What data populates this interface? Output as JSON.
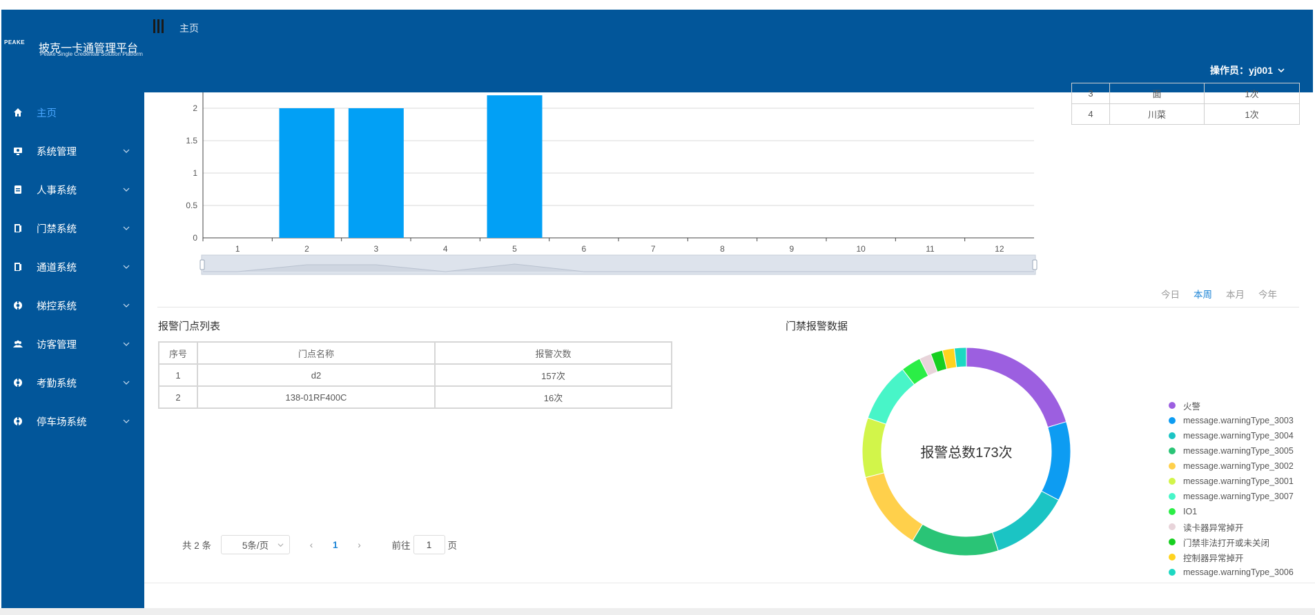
{
  "header": {
    "logo_mark": "PEAKE",
    "brand_title": "披克一卡通管理平台",
    "brand_subtitle": "Peake Single Credential Solution Platform",
    "breadcrumb": "主页",
    "operator": "操作员：yj001"
  },
  "sidebar": {
    "items": [
      {
        "label": "主页",
        "icon": "home-icon",
        "active": true
      },
      {
        "label": "系统管理",
        "icon": "monitor-icon"
      },
      {
        "label": "人事系统",
        "icon": "id-card-icon"
      },
      {
        "label": "门禁系统",
        "icon": "door-icon"
      },
      {
        "label": "通道系统",
        "icon": "gate-icon"
      },
      {
        "label": "梯控系统",
        "icon": "elevator-icon"
      },
      {
        "label": "访客管理",
        "icon": "visitors-icon"
      },
      {
        "label": "考勤系统",
        "icon": "attendance-icon"
      },
      {
        "label": "停车场系统",
        "icon": "parking-icon"
      }
    ]
  },
  "rank_table": {
    "rows": [
      [
        "3",
        "面",
        "1次"
      ],
      [
        "4",
        "川菜",
        "1次"
      ]
    ]
  },
  "period_tabs": [
    "今日",
    "本周",
    "本月",
    "今年"
  ],
  "period_active": "本周",
  "alarm_list": {
    "title": "报警门点列表",
    "columns": [
      "序号",
      "门点名称",
      "报警次数"
    ],
    "rows": [
      [
        "1",
        "d2",
        "157次"
      ],
      [
        "2",
        "138-01RF400C",
        "16次"
      ]
    ]
  },
  "pagination": {
    "total": "共 2 条",
    "page_size": "5条/页",
    "prev": "‹",
    "current": "1",
    "next": "›",
    "goto_label": "前往",
    "goto_value": "1",
    "goto_suffix": "页"
  },
  "donut_title": "门禁报警数据",
  "chart_data": [
    {
      "type": "bar",
      "categories": [
        "1",
        "2",
        "3",
        "4",
        "5",
        "6",
        "7",
        "8",
        "9",
        "10",
        "11",
        "12"
      ],
      "values": [
        0,
        2,
        2,
        0,
        2.2,
        0,
        0,
        0,
        0,
        0,
        0,
        0
      ],
      "yticks": [
        "0",
        "0.5",
        "1",
        "1.5",
        "2"
      ],
      "ylim": [
        0,
        2.2
      ],
      "color": "#02a0f5",
      "grid": true,
      "has_zoom_slider": true
    },
    {
      "type": "pie",
      "center_label": "报警总数173次",
      "series": [
        {
          "name": "火警",
          "value": 33,
          "color": "#9c5fe0"
        },
        {
          "name": "message.warningType_3003",
          "value": 20,
          "color": "#0d9cf2"
        },
        {
          "name": "message.warningType_3004",
          "value": 20,
          "color": "#1bc4c4"
        },
        {
          "name": "message.warningType_3005",
          "value": 22,
          "color": "#2ac476"
        },
        {
          "name": "message.warningType_3002",
          "value": 20,
          "color": "#ffd04b"
        },
        {
          "name": "message.warningType_3001",
          "value": 15,
          "color": "#d2f54a"
        },
        {
          "name": "message.warningType_3007",
          "value": 15,
          "color": "#48f5c8"
        },
        {
          "name": "IO1",
          "value": 5,
          "color": "#2bee46"
        },
        {
          "name": "读卡器异常掉开",
          "value": 3,
          "color": "#e8d4da"
        },
        {
          "name": "门禁非法打开或未关闭",
          "value": 3,
          "color": "#17cf20"
        },
        {
          "name": "控制器异常掉开",
          "value": 3,
          "color": "#ffd31f"
        },
        {
          "name": "message.warningType_3006",
          "value": 3,
          "color": "#1dd8c2"
        }
      ]
    }
  ]
}
